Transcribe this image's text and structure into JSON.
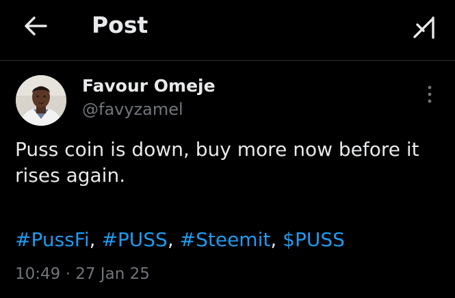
{
  "header": {
    "title": "Post",
    "back_icon": "arrow-left-icon",
    "grok_icon": "grok-icon"
  },
  "author": {
    "display_name": "Favour Omeje",
    "handle": "@favyzamel",
    "avatar_icon": "profile-photo"
  },
  "post": {
    "text": "Puss coin is down, buy more now before it rises again.",
    "tags": [
      {
        "text": "#PussFi"
      },
      {
        "text": "#PUSS"
      },
      {
        "text": "#Steemit"
      },
      {
        "text": "$PUSS"
      }
    ],
    "separator": ", ",
    "time": "10:49",
    "dot": " · ",
    "date": "27 Jan 25"
  },
  "menu": {
    "more_icon": "more-vertical-icon"
  },
  "colors": {
    "background": "#000000",
    "text_primary": "#e7e9ea",
    "text_secondary": "#71767b",
    "link": "#1d9bf0",
    "divider": "#2f3336"
  }
}
